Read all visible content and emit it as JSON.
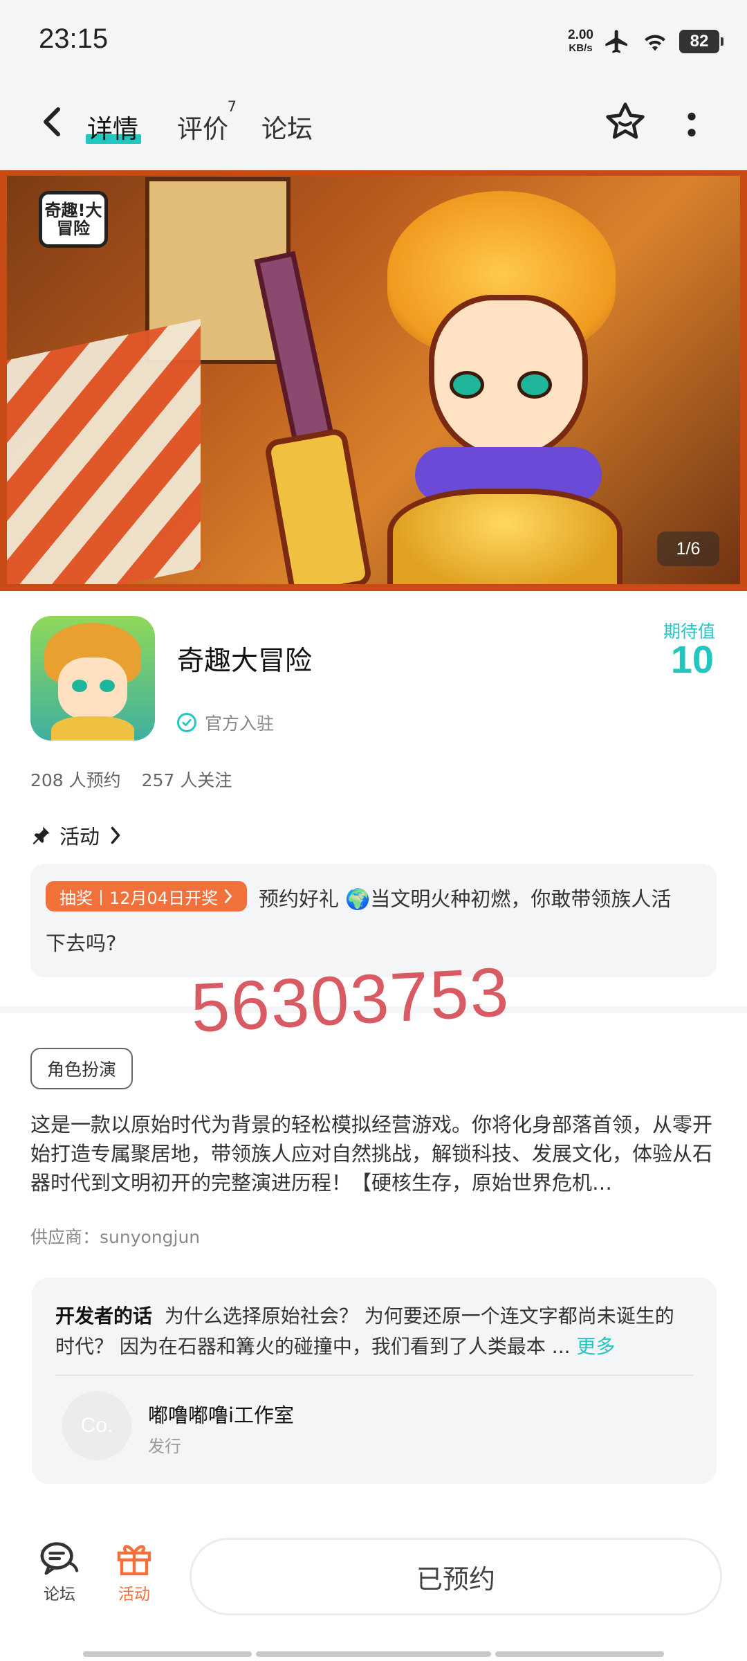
{
  "status_bar": {
    "time": "23:15",
    "net_speed_value": "2.00",
    "net_speed_unit": "KB/s",
    "battery": "82"
  },
  "nav": {
    "tabs": [
      {
        "label": "详情",
        "active": true
      },
      {
        "label": "评价",
        "badge": "7"
      },
      {
        "label": "论坛"
      }
    ]
  },
  "banner": {
    "logo_text": "奇趣!大冒险",
    "counter": "1/6"
  },
  "app": {
    "name": "奇趣大冒险",
    "official_label": "官方入驻",
    "expect_label": "期待值",
    "expect_value": "10",
    "reservations": "208 人预约",
    "followers": "257 人关注"
  },
  "activity": {
    "heading": "活动",
    "badge": "抽奖丨12月04日开奖",
    "line1": "预约好礼 🌍当文明火种初燃，你敢带领族人活",
    "line2": "下去吗?"
  },
  "watermark": "56303753",
  "tag": "角色扮演",
  "description": "这是一款以原始时代为背景的轻松模拟经营游戏。你将化身部落首领，从零开始打造专属聚居地，带领族人应对自然挑战，解锁科技、发展文化，体验从石器时代到文明初开的完整演进历程！【硬核生存，原始世界危机…",
  "supplier": "供应商：sunyongjun",
  "developer": {
    "title": "开发者的话",
    "text": "为什么选择原始社会？ 为何要还原一个连文字都尚未诞生的时代？ 因为在石器和篝火的碰撞中，我们看到了人类最本 ...",
    "more": "更多",
    "avatar_text": "Co.",
    "studio": "嘟噜嘟噜i工作室",
    "role": "发行"
  },
  "bottom_bar": {
    "forum_label": "论坛",
    "activity_label": "活动",
    "reserve_label": "已预约"
  },
  "colors": {
    "accent": "#22c7c0",
    "orange": "#f2703a",
    "watermark": "#d85a62"
  }
}
